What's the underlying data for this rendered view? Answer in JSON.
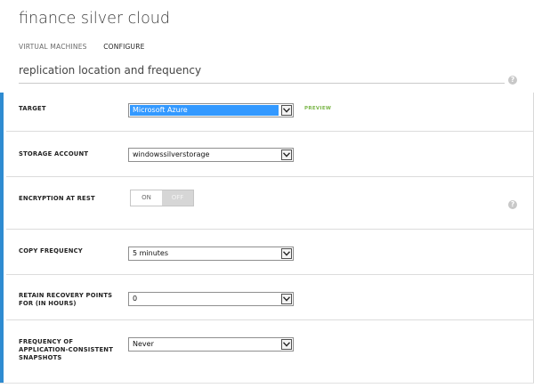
{
  "app": {
    "title": "finance silver cloud"
  },
  "tabs": [
    {
      "label": "VIRTUAL MACHINES",
      "active": false
    },
    {
      "label": "CONFIGURE",
      "active": true
    }
  ],
  "section": {
    "title": "replication location and frequency",
    "help_icon": "question-icon"
  },
  "fields": {
    "target": {
      "label": "TARGET",
      "value": "Microsoft Azure",
      "badge": "PREVIEW"
    },
    "storage_account": {
      "label": "STORAGE ACCOUNT",
      "value": "windowssilverstorage"
    },
    "encryption": {
      "label": "ENCRYPTION AT REST",
      "on_label": "ON",
      "off_label": "OFF",
      "selected": "OFF"
    },
    "copy_frequency": {
      "label": "COPY FREQUENCY",
      "value": "5 minutes"
    },
    "retain_recovery": {
      "label": "RETAIN RECOVERY POINTS FOR (IN HOURS)",
      "value": "0"
    },
    "app_consistent": {
      "label": "FREQUENCY OF APPLICATION-CONSISTENT SNAPSHOTS",
      "value": "Never"
    }
  },
  "colors": {
    "accent": "#2e8bd1",
    "selection": "#3399ff",
    "preview": "#7ab648"
  }
}
